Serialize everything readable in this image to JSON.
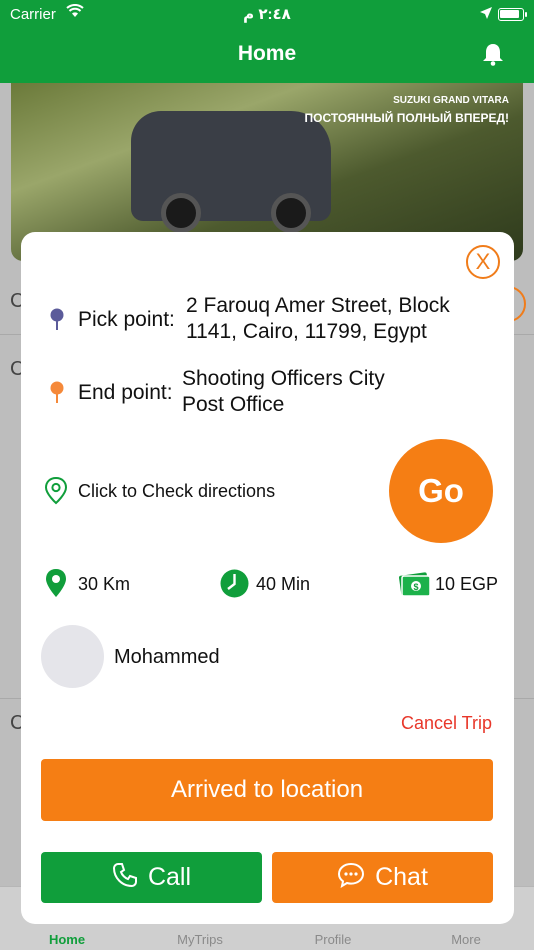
{
  "status_bar": {
    "carrier": "Carrier",
    "time": "٢:٤٨ م"
  },
  "nav": {
    "title": "Home"
  },
  "banner": {
    "brand": "SUZUKI GRAND VITARA",
    "slogan": "ПОСТОЯННЫЙ ПОЛНЫЙ ВПЕРЕД!"
  },
  "background": {
    "row_letter_1": "C",
    "row_letter_2": "C",
    "row_letter_3": "C"
  },
  "trip": {
    "close_label": "X",
    "pick_label": "Pick point:",
    "pick_line1": "2 Farouq Amer Street,  Block",
    "pick_line2": "1141, Cairo, 11799, Egypt",
    "end_label": "End point:",
    "end_line1": "Shooting Officers City",
    "end_line2": "Post Office",
    "directions_label": "Click to Check directions",
    "go_label": "Go",
    "distance": "30 Km",
    "duration": "40 Min",
    "fare": "10 EGP",
    "driver_name": "Mohammed",
    "cancel_label": "Cancel Trip",
    "arrived_label": "Arrived to location",
    "call_label": "Call",
    "chat_label": "Chat"
  },
  "tabs": [
    {
      "label": "Home",
      "icon": "home-icon",
      "active": true
    },
    {
      "label": "MyTrips",
      "icon": "trips-icon",
      "active": false
    },
    {
      "label": "Profile",
      "icon": "profile-icon",
      "active": false
    },
    {
      "label": "More",
      "icon": "more-icon",
      "active": false
    }
  ],
  "colors": {
    "brand_green": "#109e3b",
    "accent_orange": "#f57e14",
    "danger_red": "#e8372a"
  }
}
